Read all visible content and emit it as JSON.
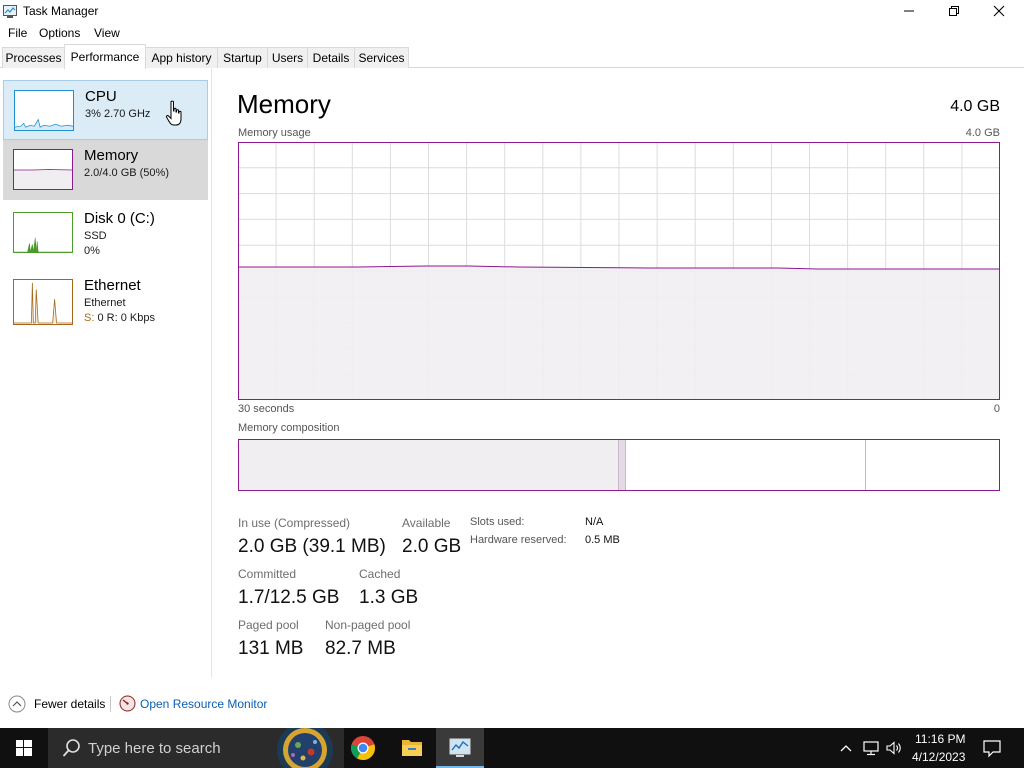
{
  "window": {
    "title": "Task Manager"
  },
  "menu": [
    "File",
    "Options",
    "View"
  ],
  "tabs": [
    "Processes",
    "Performance",
    "App history",
    "Startup",
    "Users",
    "Details",
    "Services"
  ],
  "active_tab": "Performance",
  "sidebar": {
    "items": [
      {
        "title": "CPU",
        "line1": "3%  2.70 GHz",
        "line2": "",
        "color": "#1f8fd1"
      },
      {
        "title": "Memory",
        "line1": "2.0/4.0 GB (50%)",
        "line2": "",
        "color": "#8b1a8e"
      },
      {
        "title": "Disk 0 (C:)",
        "line1": "SSD",
        "line2": "0%",
        "color": "#4c9a2a"
      },
      {
        "title": "Ethernet",
        "line1": "Ethernet",
        "line2": "S: 0  R: 0 Kbps",
        "line2_prefix": "S:",
        "line2_rest": " 0  R: 0 Kbps",
        "color": "#a7651a"
      }
    ],
    "selected": "Memory"
  },
  "main": {
    "title": "Memory",
    "total": "4.0 GB",
    "usage_label": "Memory usage",
    "usage_max": "4.0 GB",
    "time_left": "30 seconds",
    "time_right": "0",
    "composition_label": "Memory composition",
    "accent": "#8b1a8e",
    "fill": "#f1eef2"
  },
  "stats": {
    "in_use_label": "In use (Compressed)",
    "in_use_value": "2.0 GB (39.1 MB)",
    "available_label": "Available",
    "available_value": "2.0 GB",
    "committed_label": "Committed",
    "committed_value": "1.7/12.5 GB",
    "cached_label": "Cached",
    "cached_value": "1.3 GB",
    "paged_label": "Paged pool",
    "paged_value": "131 MB",
    "nonpaged_label": "Non-paged pool",
    "nonpaged_value": "82.7 MB",
    "slots_label": "Slots used:",
    "slots_value": "N/A",
    "hw_reserved_label": "Hardware reserved:",
    "hw_reserved_value": "0.5 MB"
  },
  "footer": {
    "fewer_details": "Fewer details",
    "open_resource_monitor": "Open Resource Monitor"
  },
  "taskbar": {
    "search_placeholder": "Type here to search",
    "time": "11:16 PM",
    "date": "4/12/2023",
    "apps": [
      "chrome-icon",
      "file-explorer-icon",
      "task-manager-icon"
    ]
  }
}
